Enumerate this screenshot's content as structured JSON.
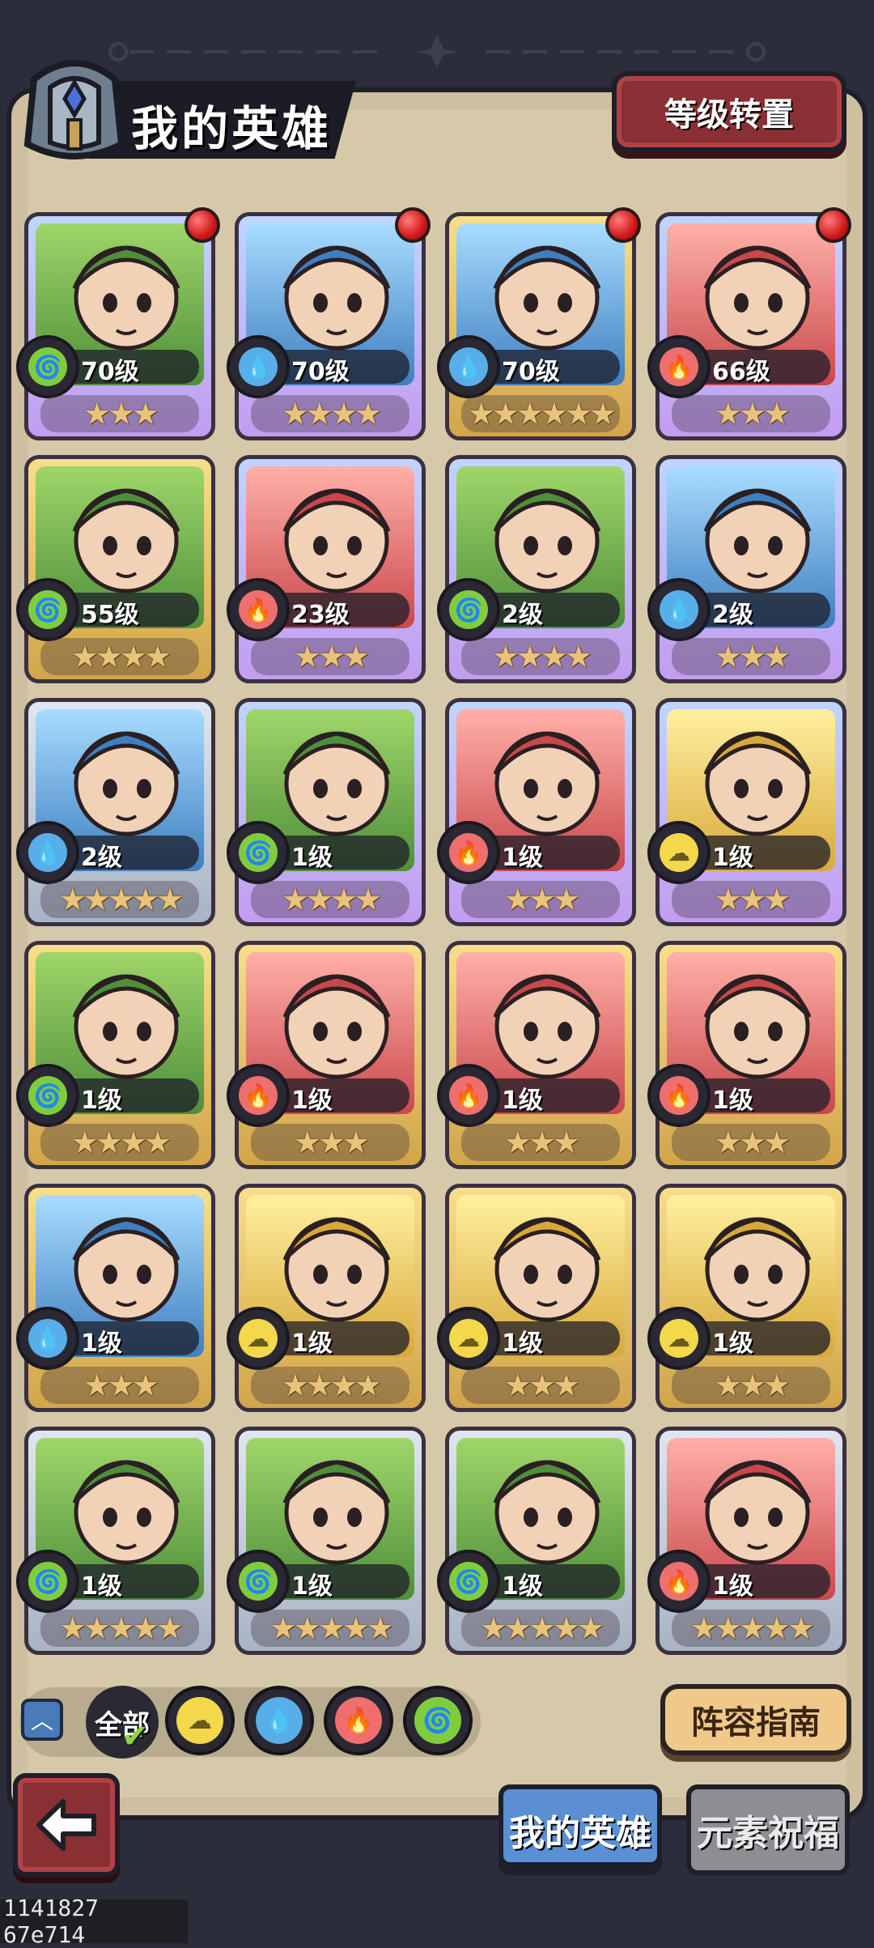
{
  "header": {
    "title": "我的英雄",
    "level_transfer_button": "等级转置"
  },
  "heroes": [
    {
      "level": "70级",
      "element": "nature",
      "stars": "★★★",
      "rarity": "purple",
      "new": true
    },
    {
      "level": "70级",
      "element": "water",
      "stars": "★★★★",
      "rarity": "purple",
      "new": true
    },
    {
      "level": "70级",
      "element": "water",
      "stars": "★★★★★★",
      "rarity": "gold",
      "new": true
    },
    {
      "level": "66级",
      "element": "fire",
      "stars": "★★★",
      "rarity": "purple",
      "new": true
    },
    {
      "level": "55级",
      "element": "nature",
      "stars": "★★★★",
      "rarity": "gold",
      "new": false
    },
    {
      "level": "23级",
      "element": "fire",
      "stars": "★★★",
      "rarity": "purple",
      "new": false
    },
    {
      "level": "2级",
      "element": "nature",
      "stars": "★★★★",
      "rarity": "purple",
      "new": false
    },
    {
      "level": "2级",
      "element": "water",
      "stars": "★★★",
      "rarity": "purple",
      "new": false
    },
    {
      "level": "2级",
      "element": "water",
      "stars": "★★★★★",
      "rarity": "silver",
      "new": false
    },
    {
      "level": "1级",
      "element": "nature",
      "stars": "★★★★",
      "rarity": "purple",
      "new": false
    },
    {
      "level": "1级",
      "element": "fire",
      "stars": "★★★",
      "rarity": "purple",
      "new": false
    },
    {
      "level": "1级",
      "element": "light",
      "stars": "★★★",
      "rarity": "purple",
      "new": false
    },
    {
      "level": "1级",
      "element": "nature",
      "stars": "★★★★",
      "rarity": "gold",
      "new": false
    },
    {
      "level": "1级",
      "element": "fire",
      "stars": "★★★",
      "rarity": "gold",
      "new": false
    },
    {
      "level": "1级",
      "element": "fire",
      "stars": "★★★",
      "rarity": "gold",
      "new": false
    },
    {
      "level": "1级",
      "element": "fire",
      "stars": "★★★",
      "rarity": "gold",
      "new": false
    },
    {
      "level": "1级",
      "element": "water",
      "stars": "★★★",
      "rarity": "gold",
      "new": false
    },
    {
      "level": "1级",
      "element": "light",
      "stars": "★★★★",
      "rarity": "gold",
      "new": false
    },
    {
      "level": "1级",
      "element": "light",
      "stars": "★★★",
      "rarity": "gold",
      "new": false
    },
    {
      "level": "1级",
      "element": "light",
      "stars": "★★★",
      "rarity": "gold",
      "new": false
    },
    {
      "level": "1级",
      "element": "nature",
      "stars": "★★★★★",
      "rarity": "silver",
      "new": false
    },
    {
      "level": "1级",
      "element": "nature",
      "stars": "★★★★★",
      "rarity": "silver",
      "new": false
    },
    {
      "level": "1级",
      "element": "nature",
      "stars": "★★★★★",
      "rarity": "silver",
      "new": false
    },
    {
      "level": "1级",
      "element": "fire",
      "stars": "★★★★★",
      "rarity": "silver",
      "new": false
    }
  ],
  "filters": {
    "all_label": "全部",
    "elements": [
      "light",
      "water",
      "fire",
      "nature"
    ]
  },
  "guide_button": "阵容指南",
  "tabs": {
    "my_heroes": "我的英雄",
    "element_blessing": "元素祝福"
  },
  "watermark": "1141827 67e714",
  "colors": {
    "nature": "#7fcc3d",
    "water": "#58aee8",
    "fire": "#ef6e6e",
    "light": "#f2d84a"
  }
}
